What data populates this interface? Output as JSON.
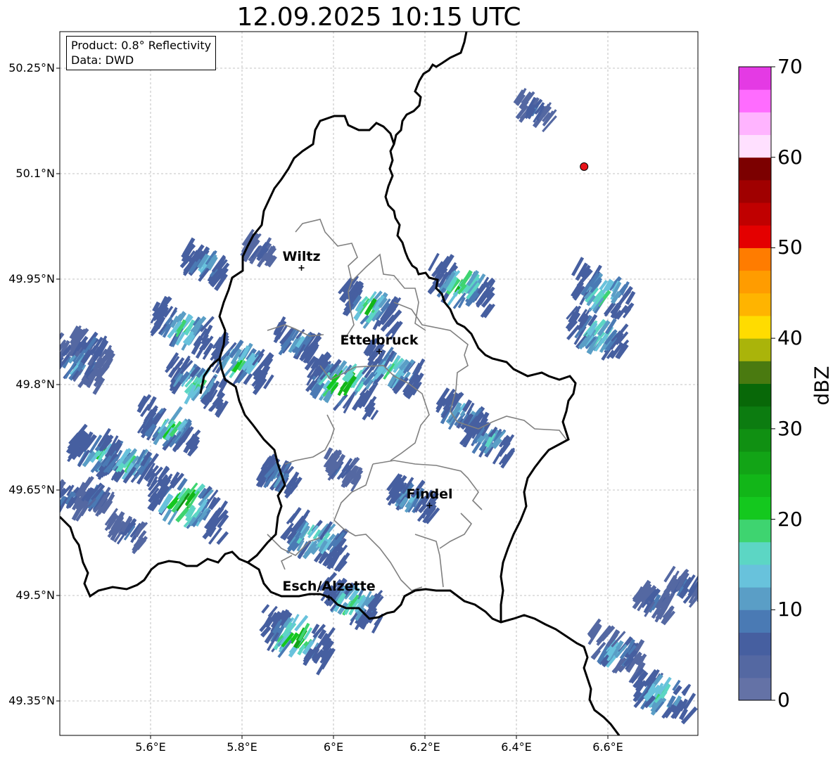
{
  "title": "12.09.2025 10:15 UTC",
  "infobox": {
    "product": "Product: 0.8° Reflectivity",
    "data": "Data: DWD"
  },
  "axes": {
    "lon_range": [
      5.4,
      6.8
    ],
    "lat_range": [
      49.3,
      50.3
    ],
    "x_ticks": [
      {
        "value": 5.6,
        "label": "5.6°E"
      },
      {
        "value": 5.8,
        "label": "5.8°E"
      },
      {
        "value": 6.0,
        "label": "6°E"
      },
      {
        "value": 6.2,
        "label": "6.2°E"
      },
      {
        "value": 6.4,
        "label": "6.4°E"
      },
      {
        "value": 6.6,
        "label": "6.6°E"
      }
    ],
    "y_ticks": [
      {
        "value": 50.25,
        "label": "50.25°N"
      },
      {
        "value": 50.1,
        "label": "50.1°N"
      },
      {
        "value": 49.95,
        "label": "49.95°N"
      },
      {
        "value": 49.8,
        "label": "49.8°N"
      },
      {
        "value": 49.65,
        "label": "49.65°N"
      },
      {
        "value": 49.5,
        "label": "49.5°N"
      },
      {
        "value": 49.35,
        "label": "49.35°N"
      }
    ],
    "grid": true
  },
  "cities": [
    {
      "name": "Wiltz",
      "lon": 5.93,
      "lat": 49.966
    },
    {
      "name": "Ettelbruck",
      "lon": 6.1,
      "lat": 49.847
    },
    {
      "name": "Findel",
      "lon": 6.21,
      "lat": 49.628
    },
    {
      "name": "Esch/Alzette",
      "lon": 5.99,
      "lat": 49.497
    }
  ],
  "radar_site": {
    "lon": 6.548,
    "lat": 50.11,
    "color": "#e8141a"
  },
  "colorbar": {
    "label": "dBZ",
    "min": 0,
    "max": 70,
    "ticks": [
      "0",
      "10",
      "20",
      "30",
      "40",
      "50",
      "60",
      "70"
    ],
    "colors": [
      "#6472a6",
      "#5468a2",
      "#465fa0",
      "#4a7ab4",
      "#5a9ec6",
      "#68c2dc",
      "#5cd6c4",
      "#3ed470",
      "#14c81e",
      "#12b618",
      "#12a416",
      "#109012",
      "#0c7c10",
      "#086808",
      "#4a7a10",
      "#aab40a",
      "#ffdc00",
      "#ffb400",
      "#ff9c00",
      "#ff7c00",
      "#e40000",
      "#c00000",
      "#a00000",
      "#7c0000",
      "#ffe0ff",
      "#ffb4ff",
      "#ff6cff",
      "#e43ae4"
    ]
  },
  "chart_data": {
    "type": "heatmap",
    "title": "12.09.2025 10:15 UTC",
    "xlim": [
      5.4,
      6.8
    ],
    "ylim": [
      49.3,
      50.3
    ],
    "color_scale": {
      "label": "dBZ",
      "range": [
        0,
        70
      ]
    },
    "echo_cells_dbz": [
      {
        "lon": 5.72,
        "lat": 49.97,
        "dbz": [
          5,
          16
        ]
      },
      {
        "lon": 5.67,
        "lat": 49.88,
        "dbz": [
          5,
          24
        ]
      },
      {
        "lon": 5.44,
        "lat": 49.83,
        "dbz": [
          3,
          20
        ]
      },
      {
        "lon": 5.47,
        "lat": 49.85,
        "dbz": [
          3,
          12
        ]
      },
      {
        "lon": 5.7,
        "lat": 49.8,
        "dbz": [
          6,
          24
        ]
      },
      {
        "lon": 5.8,
        "lat": 49.83,
        "dbz": [
          5,
          24
        ]
      },
      {
        "lon": 5.64,
        "lat": 49.74,
        "dbz": [
          5,
          24
        ]
      },
      {
        "lon": 5.49,
        "lat": 49.7,
        "dbz": [
          5,
          24
        ]
      },
      {
        "lon": 5.55,
        "lat": 49.69,
        "dbz": [
          5,
          22
        ]
      },
      {
        "lon": 5.68,
        "lat": 49.63,
        "dbz": [
          5,
          34
        ]
      },
      {
        "lon": 5.42,
        "lat": 49.64,
        "dbz": [
          3,
          12
        ]
      },
      {
        "lon": 5.48,
        "lat": 49.64,
        "dbz": [
          3,
          10
        ]
      },
      {
        "lon": 5.55,
        "lat": 49.59,
        "dbz": [
          3,
          10
        ]
      },
      {
        "lon": 5.84,
        "lat": 49.99,
        "dbz": [
          3,
          8
        ]
      },
      {
        "lon": 5.92,
        "lat": 49.86,
        "dbz": [
          5,
          16
        ]
      },
      {
        "lon": 6.02,
        "lat": 49.8,
        "dbz": [
          6,
          32
        ]
      },
      {
        "lon": 6.13,
        "lat": 49.82,
        "dbz": [
          5,
          24
        ]
      },
      {
        "lon": 6.08,
        "lat": 49.91,
        "dbz": [
          5,
          24
        ]
      },
      {
        "lon": 5.88,
        "lat": 49.67,
        "dbz": [
          5,
          14
        ]
      },
      {
        "lon": 6.02,
        "lat": 49.68,
        "dbz": [
          3,
          10
        ]
      },
      {
        "lon": 5.96,
        "lat": 49.58,
        "dbz": [
          5,
          26
        ]
      },
      {
        "lon": 6.17,
        "lat": 49.64,
        "dbz": [
          5,
          18
        ]
      },
      {
        "lon": 6.04,
        "lat": 49.49,
        "dbz": [
          5,
          24
        ]
      },
      {
        "lon": 5.92,
        "lat": 49.44,
        "dbz": [
          6,
          30
        ]
      },
      {
        "lon": 6.28,
        "lat": 49.94,
        "dbz": [
          5,
          26
        ]
      },
      {
        "lon": 6.28,
        "lat": 49.76,
        "dbz": [
          5,
          18
        ]
      },
      {
        "lon": 6.34,
        "lat": 49.72,
        "dbz": [
          5,
          18
        ]
      },
      {
        "lon": 6.58,
        "lat": 49.87,
        "dbz": [
          5,
          24
        ]
      },
      {
        "lon": 6.59,
        "lat": 49.93,
        "dbz": [
          5,
          24
        ]
      },
      {
        "lon": 6.44,
        "lat": 50.19,
        "dbz": [
          3,
          10
        ]
      },
      {
        "lon": 6.7,
        "lat": 49.49,
        "dbz": [
          3,
          10
        ]
      },
      {
        "lon": 6.77,
        "lat": 49.51,
        "dbz": [
          3,
          10
        ]
      },
      {
        "lon": 6.62,
        "lat": 49.42,
        "dbz": [
          3,
          20
        ]
      },
      {
        "lon": 6.72,
        "lat": 49.36,
        "dbz": [
          5,
          24
        ]
      }
    ]
  }
}
